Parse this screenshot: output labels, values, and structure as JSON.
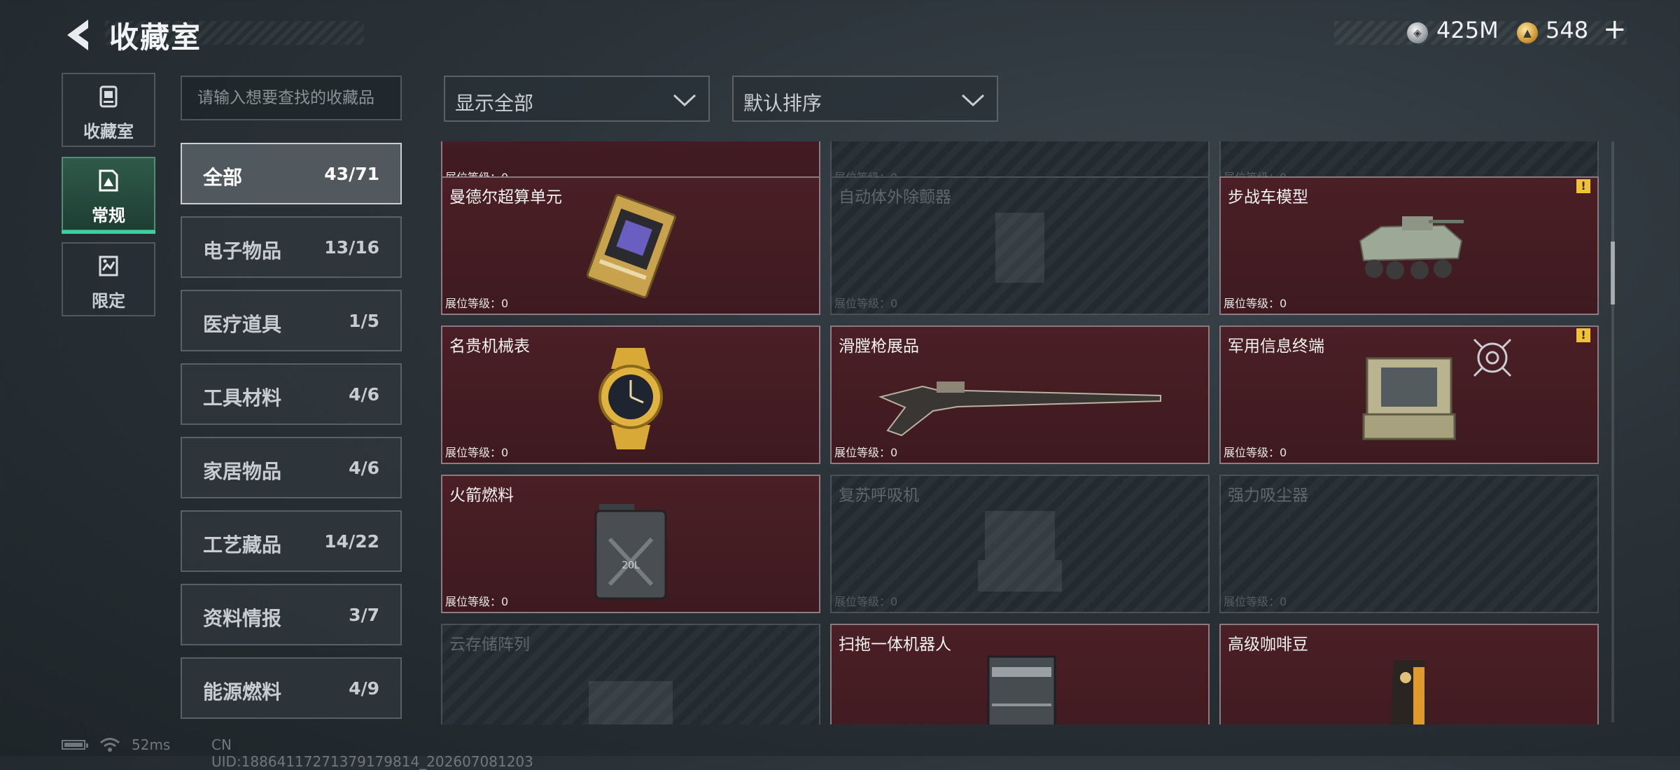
{
  "header": {
    "title": "收藏室",
    "currency": {
      "silver": "425M",
      "gold": "548",
      "plus": "+"
    }
  },
  "side_tabs": [
    {
      "label": "收藏室",
      "icon": "collection-icon",
      "active": false
    },
    {
      "label": "常规",
      "icon": "regular-icon",
      "active": true
    },
    {
      "label": "限定",
      "icon": "limited-icon",
      "active": false
    }
  ],
  "search": {
    "placeholder": "请输入想要查找的收藏品",
    "value": ""
  },
  "categories": [
    {
      "name": "全部",
      "count": "43/71",
      "active": true
    },
    {
      "name": "电子物品",
      "count": "13/16"
    },
    {
      "name": "医疗道具",
      "count": "1/5"
    },
    {
      "name": "工具材料",
      "count": "4/6"
    },
    {
      "name": "家居物品",
      "count": "4/6"
    },
    {
      "name": "工艺藏品",
      "count": "14/22"
    },
    {
      "name": "资料情报",
      "count": "3/7"
    },
    {
      "name": "能源燃料",
      "count": "4/9"
    }
  ],
  "filters": {
    "show": "显示全部",
    "sort": "默认排序"
  },
  "level_label": "展位等级：0",
  "grid": [
    {
      "name": "",
      "owned": true
    },
    {
      "name": "",
      "owned": false
    },
    {
      "name": "",
      "owned": false
    },
    {
      "name": "曼德尔超算单元",
      "owned": true,
      "art": "chip"
    },
    {
      "name": "自动体外除颤器",
      "owned": false,
      "art": "device"
    },
    {
      "name": "步战车模型",
      "owned": true,
      "art": "tank",
      "warn": true
    },
    {
      "name": "名贵机械表",
      "owned": true,
      "art": "watch"
    },
    {
      "name": "滑膛枪展品",
      "owned": true,
      "art": "rifle"
    },
    {
      "name": "军用信息终端",
      "owned": true,
      "art": "terminal",
      "warn": true,
      "target": true
    },
    {
      "name": "火箭燃料",
      "owned": true,
      "art": "jerrycan",
      "can_label": "20L"
    },
    {
      "name": "复苏呼吸机",
      "owned": false,
      "art": "terminal"
    },
    {
      "name": "强力吸尘器",
      "owned": false,
      "art": "none"
    },
    {
      "name": "云存储阵列",
      "owned": false,
      "art": "device"
    },
    {
      "name": "扫拖一体机器人",
      "owned": true,
      "art": "robot"
    },
    {
      "name": "高级咖啡豆",
      "owned": true,
      "art": "coffee"
    }
  ],
  "footer": {
    "ping": "52ms",
    "uid": "CN UID:18864117271379179814_202607081203"
  }
}
